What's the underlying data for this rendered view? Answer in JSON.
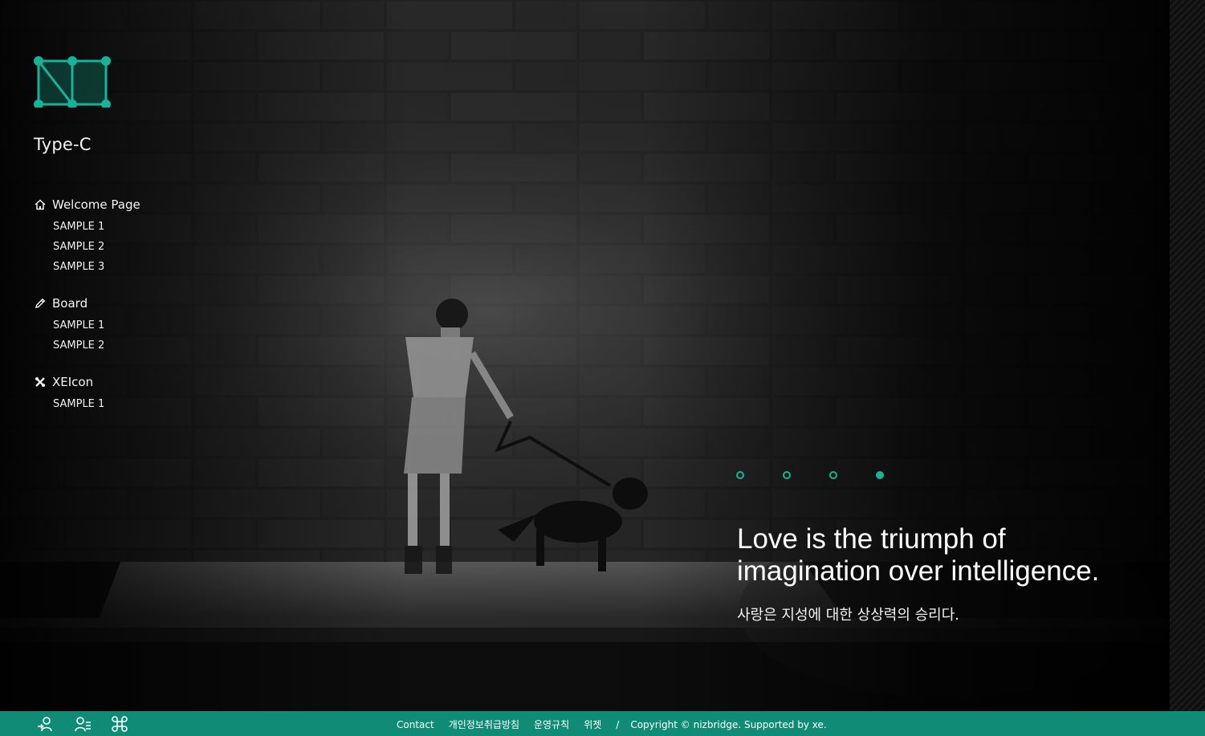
{
  "site": {
    "title": "Type-C",
    "logo_icon": "nizbridge-logo-icon",
    "accent_color": "#16b39a"
  },
  "nav": {
    "groups": [
      {
        "label": "Welcome Page",
        "icon": "home-icon",
        "items": [
          "SAMPLE 1",
          "SAMPLE 2",
          "SAMPLE 3"
        ]
      },
      {
        "label": "Board",
        "icon": "pencil-icon",
        "items": [
          "SAMPLE 1",
          "SAMPLE 2"
        ]
      },
      {
        "label": "XEIcon",
        "icon": "xeicon-icon",
        "items": [
          "SAMPLE 1"
        ]
      }
    ]
  },
  "slider": {
    "dot_count": 4,
    "active_index": 3
  },
  "hero": {
    "quote_line1": "Love is the triumph of",
    "quote_line2": "imagination over intelligence.",
    "quote_ko": "사랑은 지성에 대한 상상력의 승리다."
  },
  "footer": {
    "color": "#0f8b76",
    "icons": [
      "login-icon",
      "signup-icon",
      "command-icon"
    ],
    "links": [
      "Contact",
      "개인정보취급방침",
      "운영규칙",
      "위젯"
    ],
    "separator": "/",
    "copyright": "Copyright © nizbridge. Supported by xe."
  }
}
